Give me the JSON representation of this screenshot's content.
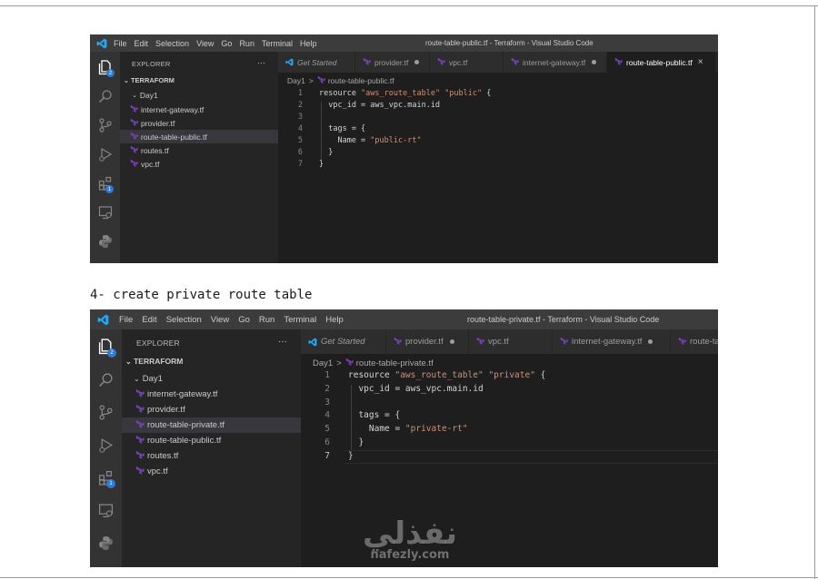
{
  "screenshot1": {
    "window_title": "route-table-public.tf - Terraform - Visual Studio Code",
    "menu": [
      "File",
      "Edit",
      "Selection",
      "View",
      "Go",
      "Run",
      "Terminal",
      "Help"
    ],
    "explorer_title": "EXPLORER",
    "explorer_more": "···",
    "workspace": "TERRAFORM",
    "folder": "Day1",
    "files": [
      "internet-gateway.tf",
      "provider.tf",
      "route-table-public.tf",
      "routes.tf",
      "vpc.tf"
    ],
    "selected_file": "route-table-public.tf",
    "tabs": [
      "Get Started",
      "provider.tf",
      "vpc.tf",
      "internet-gateway.tf",
      "route-table-public.tf"
    ],
    "tab_close": "×",
    "breadcrumb": {
      "folder": "Day1",
      "sep": ">",
      "file": "route-table-public.tf"
    },
    "badges": {
      "explorer": "2",
      "extensions": "1"
    },
    "code": {
      "line_numbers": [
        "1",
        "2",
        "3",
        "4",
        "5",
        "6",
        "7"
      ],
      "lines": [
        "resource \"aws_route_table\" \"public\" {",
        "  vpc_id = aws_vpc.main.id",
        "",
        "  tags = {",
        "    Name = \"public-rt\"",
        "  }",
        "}"
      ]
    }
  },
  "caption": "4- create private route table",
  "screenshot2": {
    "window_title": "route-table-private.tf - Terraform - Visual Studio Code",
    "menu": [
      "File",
      "Edit",
      "Selection",
      "View",
      "Go",
      "Run",
      "Terminal",
      "Help"
    ],
    "explorer_title": "EXPLORER",
    "explorer_more": "···",
    "workspace": "TERRAFORM",
    "folder": "Day1",
    "files": [
      "internet-gateway.tf",
      "provider.tf",
      "route-table-private.tf",
      "route-table-public.tf",
      "routes.tf",
      "vpc.tf"
    ],
    "selected_file": "route-table-private.tf",
    "tabs": [
      "Get Started",
      "provider.tf",
      "vpc.tf",
      "internet-gateway.tf",
      "route-ta"
    ],
    "breadcrumb": {
      "folder": "Day1",
      "sep": ">",
      "file": "route-table-private.tf"
    },
    "badges": {
      "explorer": "2",
      "extensions": "1"
    },
    "code": {
      "line_numbers": [
        "1",
        "2",
        "3",
        "4",
        "5",
        "6",
        "7"
      ],
      "lines": [
        "resource \"aws_route_table\" \"private\" {",
        "  vpc_id = aws_vpc.main.id",
        "",
        "  tags = {",
        "    Name = \"private-rt\"",
        "  }",
        "}"
      ]
    }
  },
  "watermark": {
    "arabic": "نفذلي",
    "latin": "nafezly.com"
  },
  "colors": {
    "terraform_icon": "#7b42bc",
    "vscode_blue": "#23a9f2",
    "string": "#ce9178",
    "badge": "#2f7ad3"
  }
}
